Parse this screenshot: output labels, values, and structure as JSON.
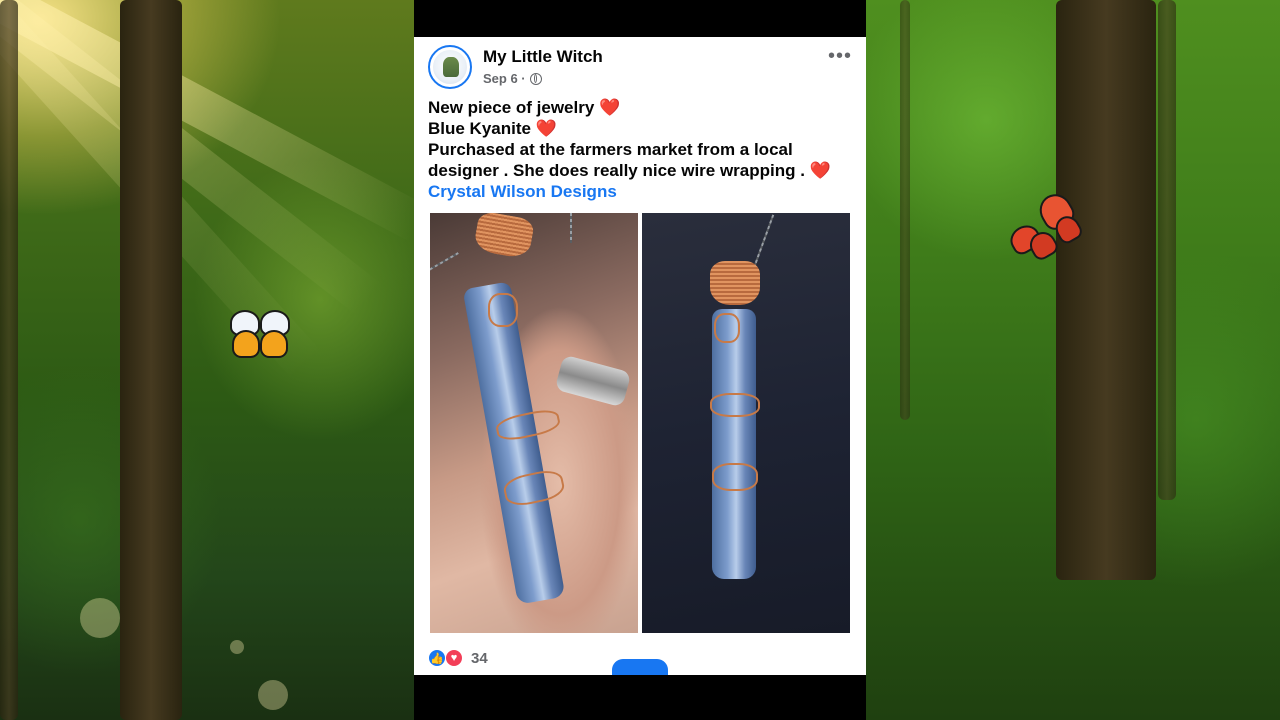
{
  "post": {
    "author": "My Little Witch",
    "date": "Sep 6 ·",
    "lines": [
      "New piece of jewelry",
      "Blue Kyanite",
      "Purchased at the farmers market from a local",
      "designer . She does really nice wire wrapping ."
    ],
    "link_text": "Crystal Wilson Designs",
    "heart": "❤️",
    "more": "•••",
    "reaction_count": "34",
    "like_glyph": "👍",
    "love_glyph": "♥"
  },
  "icons": [
    "globe-icon",
    "more-icon",
    "like-icon",
    "love-icon",
    "heart-icon"
  ],
  "colors": {
    "link": "#1877f2",
    "heart": "#e21b2d",
    "love": "#f33e58"
  }
}
